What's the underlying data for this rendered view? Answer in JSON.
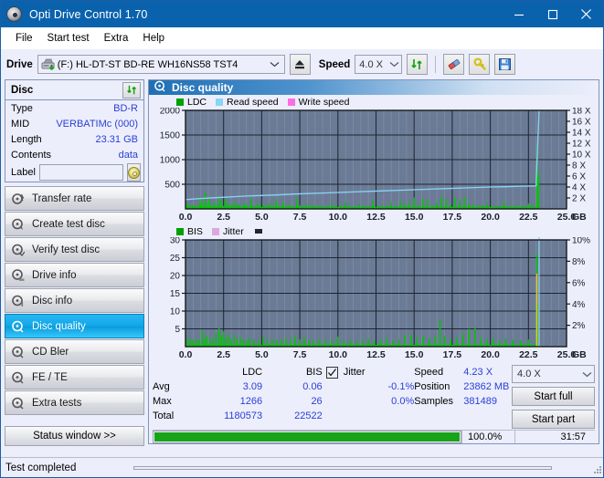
{
  "window": {
    "title": "Opti Drive Control 1.70",
    "icon": "disc-icon",
    "minimize": "minimize-icon",
    "maximize": "maximize-icon",
    "close": "close-icon"
  },
  "menu": {
    "items": [
      "File",
      "Start test",
      "Extra",
      "Help"
    ]
  },
  "toolbar": {
    "drive_label": "Drive",
    "drive_value": "(F:)  HL-DT-ST BD-RE  WH16NS58 TST4",
    "eject_icon": "eject-icon",
    "speed_label": "Speed",
    "speed_value": "4.0 X",
    "refresh_icon": "refresh-icon",
    "eraser_icon": "eraser-icon",
    "plugin_icon": "plug-icon",
    "save_icon": "save-icon"
  },
  "disc": {
    "title": "Disc",
    "refresh_icon": "refresh-icon",
    "rows": [
      {
        "key": "Type",
        "value": "BD-R"
      },
      {
        "key": "MID",
        "value": "VERBATIMc (000)"
      },
      {
        "key": "Length",
        "value": "23.31 GB"
      },
      {
        "key": "Contents",
        "value": "data"
      }
    ],
    "label_key": "Label",
    "label_value": "",
    "label_placeholder": "",
    "label_button_icon": "cd-icon"
  },
  "nav": {
    "items": [
      {
        "label": "Transfer rate",
        "icon": "disc-transfer-icon",
        "selected": false
      },
      {
        "label": "Create test disc",
        "icon": "disc-create-icon",
        "selected": false
      },
      {
        "label": "Verify test disc",
        "icon": "disc-verify-icon",
        "selected": false
      },
      {
        "label": "Drive info",
        "icon": "disc-drive-icon",
        "selected": false
      },
      {
        "label": "Disc info",
        "icon": "disc-info-icon",
        "selected": false
      },
      {
        "label": "Disc quality",
        "icon": "disc-quality-icon",
        "selected": true
      },
      {
        "label": "CD Bler",
        "icon": "disc-bler-icon",
        "selected": false
      },
      {
        "label": "FE / TE",
        "icon": "disc-fete-icon",
        "selected": false
      },
      {
        "label": "Extra tests",
        "icon": "disc-extra-icon",
        "selected": false
      }
    ],
    "status_window": "Status window >>"
  },
  "panel": {
    "title": "Disc quality",
    "icon": "disc-quality-icon"
  },
  "chart_data": [
    {
      "type": "line",
      "title": "LDC / Read speed",
      "legend": [
        {
          "label": "LDC",
          "color": "#00a000"
        },
        {
          "label": "Read speed",
          "color": "#8ad4f5"
        },
        {
          "label": "Write speed",
          "color": "#ff6ee0"
        }
      ],
      "legend_position": "top-left",
      "grid": true,
      "xlabel": "GB",
      "xlim": [
        0,
        25
      ],
      "xticks": [
        "0.0",
        "2.5",
        "5.0",
        "7.5",
        "10.0",
        "12.5",
        "15.0",
        "17.5",
        "20.0",
        "22.5",
        "25.0"
      ],
      "ylabel_left": "",
      "ylim_left": [
        0,
        2000
      ],
      "yticks_left": [
        "2000",
        "1500",
        "1000",
        "500"
      ],
      "ylabel_right": "X",
      "ylim_right": [
        0,
        18
      ],
      "yticks_right": [
        "18 X",
        "16 X",
        "14 X",
        "12 X",
        "10 X",
        "8 X",
        "6 X",
        "4 X",
        "2 X"
      ],
      "plot_bg": "#6b7b96",
      "series": [
        {
          "name": "LDC",
          "type": "spikes",
          "color": "#00c800",
          "x": [
            0.12,
            0.3,
            0.45,
            0.62,
            0.8,
            0.95,
            1.05,
            1.18,
            1.3,
            1.42,
            1.55,
            1.62,
            1.75,
            1.9,
            2.05,
            2.2,
            2.35,
            2.5,
            2.62,
            2.75,
            2.9,
            3.05,
            3.2,
            3.35,
            3.5,
            3.65,
            3.8,
            3.95,
            4.1,
            4.3,
            4.5,
            4.7,
            4.9,
            5.1,
            5.3,
            5.5,
            5.75,
            5.95,
            6.15,
            6.4,
            6.6,
            6.85,
            7.05,
            7.3,
            7.5,
            7.7,
            7.95,
            8.2,
            8.45,
            8.7,
            9.0,
            9.3,
            9.6,
            9.9,
            10.2,
            10.5,
            10.8,
            11.1,
            11.4,
            11.7,
            12.0,
            12.3,
            12.6,
            12.9,
            13.2,
            13.5,
            13.8,
            14.1,
            14.4,
            14.7,
            15.0,
            15.3,
            15.6,
            15.9,
            16.2,
            16.5,
            16.8,
            17.1,
            17.4,
            17.7,
            18.0,
            18.3,
            18.6,
            18.9,
            19.2,
            19.5,
            19.8,
            20.1,
            20.5,
            20.9,
            21.3,
            21.7,
            22.1,
            22.5,
            22.8,
            23.08,
            23.15
          ],
          "y": [
            120,
            60,
            90,
            55,
            70,
            140,
            210,
            85,
            330,
            110,
            230,
            60,
            95,
            130,
            70,
            250,
            180,
            60,
            200,
            115,
            75,
            90,
            150,
            60,
            100,
            55,
            75,
            120,
            70,
            210,
            60,
            90,
            130,
            55,
            80,
            115,
            65,
            200,
            80,
            140,
            60,
            90,
            55,
            220,
            70,
            60,
            110,
            55,
            80,
            60,
            55,
            50,
            120,
            55,
            60,
            140,
            50,
            55,
            95,
            60,
            55,
            180,
            60,
            70,
            55,
            130,
            60,
            170,
            95,
            140,
            230,
            80,
            210,
            175,
            60,
            130,
            250,
            195,
            90,
            230,
            170,
            250,
            110,
            90,
            60,
            80,
            115,
            55,
            60,
            150,
            55,
            95,
            60,
            110,
            70,
            1266,
            700
          ]
        },
        {
          "name": "Read speed",
          "type": "line",
          "color": "#8ad4f5",
          "x": [
            0.0,
            1.0,
            2.0,
            3.0,
            4.0,
            5.0,
            6.0,
            7.0,
            8.0,
            9.0,
            10.0,
            11.0,
            12.0,
            13.0,
            14.0,
            15.0,
            16.0,
            17.0,
            18.0,
            19.0,
            20.0,
            21.0,
            22.0,
            23.0,
            23.2
          ],
          "y": [
            1.7,
            1.9,
            2.05,
            2.2,
            2.35,
            2.45,
            2.55,
            2.7,
            2.8,
            2.9,
            3.0,
            3.1,
            3.2,
            3.3,
            3.4,
            3.5,
            3.6,
            3.7,
            3.8,
            3.9,
            4.0,
            4.05,
            4.15,
            4.2,
            18.0
          ]
        }
      ]
    },
    {
      "type": "line",
      "title": "BIS / Jitter",
      "legend": [
        {
          "label": "BIS",
          "color": "#00a000"
        },
        {
          "label": "Jitter",
          "color": "#d9a8dd"
        }
      ],
      "legend_position": "top-left",
      "grid": true,
      "xlabel": "GB",
      "xlim": [
        0,
        25
      ],
      "xticks": [
        "0.0",
        "2.5",
        "5.0",
        "7.5",
        "10.0",
        "12.5",
        "15.0",
        "17.5",
        "20.0",
        "22.5",
        "25.0"
      ],
      "ylim_left": [
        0,
        30
      ],
      "yticks_left": [
        "30",
        "25",
        "20",
        "15",
        "10",
        "5"
      ],
      "ylim_right": [
        0,
        10
      ],
      "yticks_right": [
        "10%",
        "8%",
        "6%",
        "4%",
        "2%"
      ],
      "plot_bg": "#6b7b96",
      "series": [
        {
          "name": "BIS",
          "type": "spikes",
          "color": "#00c800",
          "x": [
            0.1,
            0.3,
            0.5,
            0.7,
            0.9,
            1.1,
            1.25,
            1.4,
            1.6,
            1.8,
            2.0,
            2.2,
            2.35,
            2.5,
            2.65,
            2.8,
            3.0,
            3.2,
            3.4,
            3.6,
            3.8,
            4.0,
            4.2,
            4.5,
            4.8,
            5.1,
            5.4,
            5.7,
            6.0,
            6.3,
            6.6,
            6.9,
            7.2,
            7.5,
            7.8,
            8.1,
            8.4,
            8.8,
            9.2,
            9.6,
            10.0,
            10.4,
            10.8,
            11.2,
            11.6,
            12.0,
            12.4,
            12.8,
            13.2,
            13.6,
            14.0,
            14.4,
            14.8,
            15.2,
            15.6,
            16.0,
            16.4,
            16.7,
            17.0,
            17.4,
            17.8,
            18.2,
            18.6,
            19.0,
            19.4,
            19.8,
            20.2,
            20.6,
            21.0,
            21.5,
            22.0,
            22.5,
            23.05,
            23.1
          ],
          "y": [
            2.0,
            2.4,
            1.8,
            2.2,
            2.0,
            4.6,
            2.2,
            3.0,
            2.5,
            2.0,
            4.0,
            5.2,
            3.0,
            4.3,
            2.4,
            3.2,
            2.0,
            3.4,
            2.2,
            2.6,
            2.0,
            1.8,
            2.4,
            2.0,
            1.8,
            2.8,
            2.0,
            2.2,
            1.8,
            2.0,
            2.4,
            2.0,
            3.2,
            2.0,
            2.6,
            1.8,
            2.0,
            2.2,
            1.8,
            2.0,
            2.8,
            1.8,
            2.0,
            1.6,
            2.0,
            2.2,
            1.8,
            2.0,
            2.4,
            1.8,
            2.0,
            3.2,
            3.4,
            2.6,
            3.0,
            2.4,
            2.8,
            7.6,
            3.0,
            2.2,
            2.6,
            3.6,
            5.0,
            5.4,
            2.6,
            2.0,
            2.4,
            1.8,
            2.2,
            2.0,
            1.8,
            2.0,
            26.0,
            12.0
          ]
        },
        {
          "name": "Jitter",
          "type": "spike",
          "color": "#e8c23a",
          "x": [
            23.05
          ],
          "y": [
            20.5
          ]
        },
        {
          "name": "marker",
          "type": "line",
          "color": "#8ad4f5",
          "x": [
            23.2,
            23.2
          ],
          "y": [
            0,
            30
          ]
        }
      ]
    }
  ],
  "stats": {
    "columns": [
      "LDC",
      "BIS"
    ],
    "rows": [
      {
        "label": "Avg",
        "ldc": "3.09",
        "bis": "0.06",
        "jitter": "-0.1%"
      },
      {
        "label": "Max",
        "ldc": "1266",
        "bis": "26",
        "jitter": "0.0%"
      },
      {
        "label": "Total",
        "ldc": "1180573",
        "bis": "22522",
        "jitter": ""
      }
    ],
    "jitter_label": "Jitter",
    "jitter_checked": true,
    "speed_label": "Speed",
    "speed_value": "4.23 X",
    "position_label": "Position",
    "position_value": "23862 MB",
    "samples_label": "Samples",
    "samples_value": "381489",
    "speed_select": "4.0 X",
    "start_full": "Start full",
    "start_part": "Start part",
    "progress_pct": "100.0%",
    "elapsed": "31:57",
    "progress_value": 100
  },
  "statusbar": {
    "text": "Test completed",
    "progress_value": 100
  },
  "colors": {
    "title_bar": "#0a62ad",
    "accent": "#2b3fd8",
    "plot_bg": "#6b7b96",
    "ldc_green": "#00c800",
    "read_speed": "#8ad4f5",
    "write_speed": "#ff6ee0",
    "jitter": "#d9a8dd",
    "progress_green": "#19a319",
    "selected_nav": "#12a7e8"
  }
}
